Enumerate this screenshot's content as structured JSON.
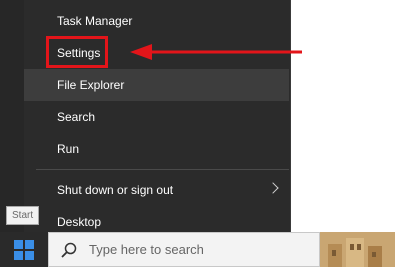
{
  "menu": {
    "items": [
      {
        "label": "Task Manager"
      },
      {
        "label": "Settings"
      },
      {
        "label": "File Explorer"
      },
      {
        "label": "Search"
      },
      {
        "label": "Run"
      },
      {
        "label": "Shut down or sign out"
      },
      {
        "label": "Desktop"
      }
    ],
    "highlighted_item": "Settings",
    "hovered_item": "File Explorer"
  },
  "tooltip": {
    "text": "Start"
  },
  "taskbar": {
    "search": {
      "placeholder": "Type here to search"
    }
  },
  "icons": {
    "start": "windows-logo-icon",
    "search": "search-icon",
    "submenu": "chevron-right-icon",
    "annotation": "arrow-left-icon"
  },
  "colors": {
    "menu_background": "#2b2b2b",
    "menu_hover": "#3d3d3d",
    "menu_text": "#ffffff",
    "annotation_red": "#e3151a",
    "start_icon_blue": "#3a8ee6"
  }
}
